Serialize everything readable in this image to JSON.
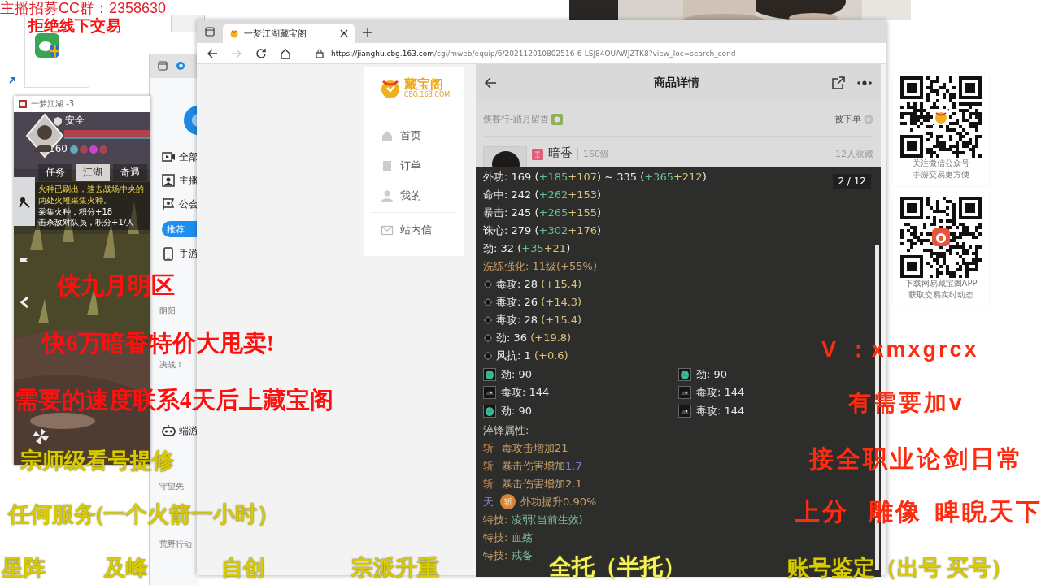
{
  "cc_window": {
    "nav": [
      {
        "label": "全部",
        "kind": "video"
      },
      {
        "label": "主播",
        "kind": "anchor"
      },
      {
        "label": "公会",
        "kind": "flag"
      }
    ],
    "button": "推荐",
    "sections": [
      {
        "label": "手游",
        "kind": "phone",
        "games": [
          "阴阳",
          "决战！"
        ]
      },
      {
        "label": "端游",
        "kind": "gamepad",
        "games": [
          "守望先",
          "荒野行动"
        ]
      }
    ]
  },
  "game_window": {
    "title": "一梦江湖 -3",
    "status": "安全",
    "level": "160",
    "tabs": [
      {
        "label": "任务",
        "selected": false
      },
      {
        "label": "江湖",
        "selected": true
      },
      {
        "label": "奇遇",
        "selected": false
      }
    ],
    "quest": "火种已刷出，速去战场中央的两处火堆采集火种。",
    "rewards": [
      "采集火种，积分+18",
      "击杀敌对队员，积分+1/人"
    ]
  },
  "browser": {
    "tab": {
      "title": "一梦江湖藏宝阁"
    },
    "url": {
      "host": "https://jianghu.cbg.163.com",
      "path": "/cgi/mweb/equip/6/202112010802516-6-LSJ84OUAWJZTK8?view_loc=search_cond"
    },
    "logo": {
      "name": "藏宝阁",
      "domain": "CBG.163.COM"
    },
    "nav_items": [
      {
        "label": "首页",
        "kind": "home"
      },
      {
        "label": "订单",
        "kind": "order"
      },
      {
        "label": "我的",
        "kind": "user"
      },
      {
        "label": "站内信",
        "kind": "mail"
      }
    ],
    "detail": {
      "title": "商品详情",
      "server": "侠客行-踏月留香",
      "order_status": "被下单",
      "name": "暗香",
      "level": "160级",
      "favorites": "12人收藏",
      "viewer": {
        "counter": "2 / 12",
        "stats": [
          {
            "kind": "plain",
            "segments": [
              {
                "text": "外功: 169 (",
                "kind": "white"
              },
              {
                "text": "+185",
                "kind": "green"
              },
              {
                "text": "+107",
                "kind": "gold"
              },
              {
                "text": ") ~ 335 (",
                "kind": "white"
              },
              {
                "text": "+365",
                "kind": "green"
              },
              {
                "text": "+212",
                "kind": "gold"
              },
              {
                "text": ")",
                "kind": "white"
              }
            ]
          },
          {
            "kind": "plain",
            "segments": [
              {
                "text": "命中: 242 (",
                "kind": "white"
              },
              {
                "text": "+262",
                "kind": "green"
              },
              {
                "text": "+153",
                "kind": "gold"
              },
              {
                "text": ")",
                "kind": "white"
              }
            ]
          },
          {
            "kind": "plain",
            "segments": [
              {
                "text": "暴击: 245 (",
                "kind": "white"
              },
              {
                "text": "+265",
                "kind": "green"
              },
              {
                "text": "+155",
                "kind": "gold"
              },
              {
                "text": ")",
                "kind": "white"
              }
            ]
          },
          {
            "kind": "plain",
            "segments": [
              {
                "text": "诛心: 279 (",
                "kind": "white"
              },
              {
                "text": "+302",
                "kind": "green"
              },
              {
                "text": "+176",
                "kind": "gold"
              },
              {
                "text": ")",
                "kind": "white"
              }
            ]
          },
          {
            "kind": "plain",
            "segments": [
              {
                "text": "劲: 32 (",
                "kind": "white"
              },
              {
                "text": "+35",
                "kind": "green"
              },
              {
                "text": "+21",
                "kind": "gold"
              },
              {
                "text": ")",
                "kind": "white"
              }
            ]
          },
          {
            "kind": "plain",
            "segments": [
              {
                "text": "洗练强化: 11级(+55%)",
                "kind": "tan"
              }
            ]
          },
          {
            "kind": "bullet",
            "segments": [
              {
                "text": "毒攻: 28 ",
                "kind": "white"
              },
              {
                "text": "(+15.4)",
                "kind": "gold"
              }
            ]
          },
          {
            "kind": "bullet",
            "segments": [
              {
                "text": "毒攻: 26 ",
                "kind": "white"
              },
              {
                "text": "(+14.3)",
                "kind": "gold"
              }
            ]
          },
          {
            "kind": "bullet",
            "segments": [
              {
                "text": "毒攻: 28 ",
                "kind": "white"
              },
              {
                "text": "(+15.4)",
                "kind": "gold"
              }
            ]
          },
          {
            "kind": "bullet",
            "segments": [
              {
                "text": "劲: 36 ",
                "kind": "white"
              },
              {
                "text": "(+19.8)",
                "kind": "gold"
              }
            ]
          },
          {
            "kind": "bullet",
            "segments": [
              {
                "text": "风抗: 1 ",
                "kind": "white"
              },
              {
                "text": "(+0.6)",
                "kind": "gold"
              }
            ]
          }
        ],
        "gems": [
          {
            "text": "劲: 90",
            "kind": "jade"
          },
          {
            "text": "劲: 90",
            "kind": "jade"
          },
          {
            "text": "毒攻: 144",
            "kind": "onyx"
          },
          {
            "text": "毒攻: 144",
            "kind": "onyx"
          },
          {
            "text": "劲: 90",
            "kind": "jade"
          },
          {
            "text": "毒攻: 144",
            "kind": "onyx"
          }
        ],
        "refine_title": "淬锋属性:",
        "refines": [
          {
            "tag": "斩",
            "kind": "slash",
            "segments": [
              {
                "text": "毒攻击增加21",
                "kind": "tan"
              }
            ]
          },
          {
            "tag": "斩",
            "kind": "slash",
            "segments": [
              {
                "text": "暴击伤害增加",
                "kind": "tan"
              },
              {
                "text": "1.7",
                "kind": "purple"
              }
            ]
          },
          {
            "tag": "斩",
            "kind": "slash",
            "segments": [
              {
                "text": "暴击伤害增加2.1",
                "kind": "tan"
              }
            ]
          },
          {
            "tag": "天",
            "kind": "sky",
            "emblem": "斩",
            "segments": [
              {
                "text": "外功提升0.90%",
                "kind": "tan"
              }
            ]
          }
        ],
        "skills": [
          {
            "label": "特技: ",
            "value": "凌弱(当前生效)"
          },
          {
            "label": "特技: ",
            "value": "血殇"
          },
          {
            "label": "特技: ",
            "value": "戒备"
          }
        ]
      }
    }
  },
  "qr_cards": [
    {
      "kind": "cbg",
      "caption": [
        "关注微信公众号",
        "手游交易更方便"
      ]
    },
    {
      "kind": "app",
      "caption": [
        "下载网易藏宝阁APP",
        "获取交易实时动态"
      ]
    }
  ],
  "overlay_texts": [
    {
      "text": "主播招募CC群：2358630",
      "kind": "sans_red"
    },
    {
      "text": "拒绝线下交易",
      "kind": "serif_red"
    },
    {
      "text": "侠九月明区",
      "kind": "serif_red"
    },
    {
      "text": "快6万暗香特价大甩卖!",
      "kind": "serif_red"
    },
    {
      "text": "V ：xmxgrcx",
      "kind": "bold_red"
    },
    {
      "text": "需要的速度联系4天后上藏宝阁",
      "kind": "serif_red"
    },
    {
      "text": "有需要加v",
      "kind": "bold_red"
    },
    {
      "text": "宗师级看号提修",
      "kind": "yellow"
    },
    {
      "text": "接全职业论剑日常",
      "kind": "bold_red"
    },
    {
      "text": "任何服务(一个火箭一小时）",
      "kind": "yellow"
    },
    {
      "text": "上分",
      "kind": "bold_red"
    },
    {
      "text": "雕像",
      "kind": "bold_red"
    },
    {
      "text": "睥睨天下",
      "kind": "bold_red"
    },
    {
      "text": "星阵",
      "kind": "yellow"
    },
    {
      "text": "及峰",
      "kind": "yellow"
    },
    {
      "text": "自创",
      "kind": "yellow"
    },
    {
      "text": "宗派升重",
      "kind": "yellow"
    },
    {
      "text": "全托（半托）",
      "kind": "bright_yellow"
    },
    {
      "text": "账号鉴定（出号 买号）",
      "kind": "yellow"
    }
  ]
}
